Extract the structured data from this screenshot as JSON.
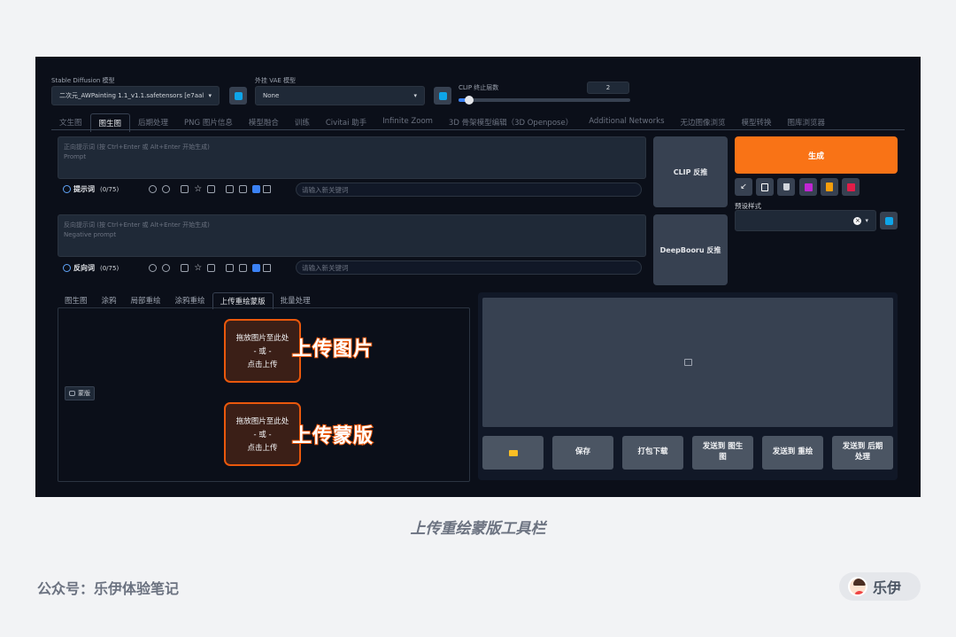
{
  "model": {
    "label": "Stable Diffusion 模型",
    "value": "二次元_AWPainting 1.1_v1.1.safetensors [e7aal"
  },
  "vae": {
    "label": "外挂 VAE 模型",
    "value": "None"
  },
  "clip": {
    "label": "CLIP 终止层数",
    "value": "2",
    "slider_fraction": 0.06
  },
  "tabs": [
    "文生图",
    "图生图",
    "后期处理",
    "PNG 图片信息",
    "模型融合",
    "训练",
    "Civitai 助手",
    "Infinite Zoom",
    "3D 骨架模型编辑（3D Openpose）",
    "Additional Networks",
    "无边图像浏览",
    "模型转换",
    "图库浏览器"
  ],
  "active_tab": 1,
  "prompt": {
    "placeholder_line1": "正向提示词 (按 Ctrl+Enter 或 Alt+Enter 开始生成)",
    "placeholder_line2": "Prompt",
    "title": "提示词",
    "count": "(0/75)",
    "keyword_placeholder": "请输入新关键词"
  },
  "neg_prompt": {
    "placeholder_line1": "反向提示词 (按 Ctrl+Enter 或 Alt+Enter 开始生成)",
    "placeholder_line2": "Negative prompt",
    "title": "反向词",
    "count": "(0/75)",
    "keyword_placeholder": "请输入新关键词"
  },
  "clip_interrogate": "CLIP 反推",
  "deepbooru": "DeepBooru 反推",
  "generate": "生成",
  "styles_label": "预设样式",
  "subtabs": [
    "图生图",
    "涂鸦",
    "局部重绘",
    "涂鸦重绘",
    "上传重绘蒙版",
    "批量处理"
  ],
  "active_subtab": 4,
  "upload_image": {
    "line1": "拖放图片至此处",
    "line2": "- 或 -",
    "line3": "点击上传"
  },
  "upload_mask": {
    "line1": "拖放图片至此处",
    "line2": "- 或 -",
    "line3": "点击上传"
  },
  "callout_image": "上传图片",
  "callout_mask": "上传蒙版",
  "mask_badge": "蒙版",
  "actions": {
    "save": "保存",
    "zip": "打包下载",
    "send_img2img": "发送到 图生图",
    "send_inpaint": "发送到 重绘",
    "send_extras": "发送到 后期处理"
  },
  "caption": "上传重绘蒙版工具栏",
  "footer": "公众号：乐伊体验笔记",
  "author": "乐伊"
}
